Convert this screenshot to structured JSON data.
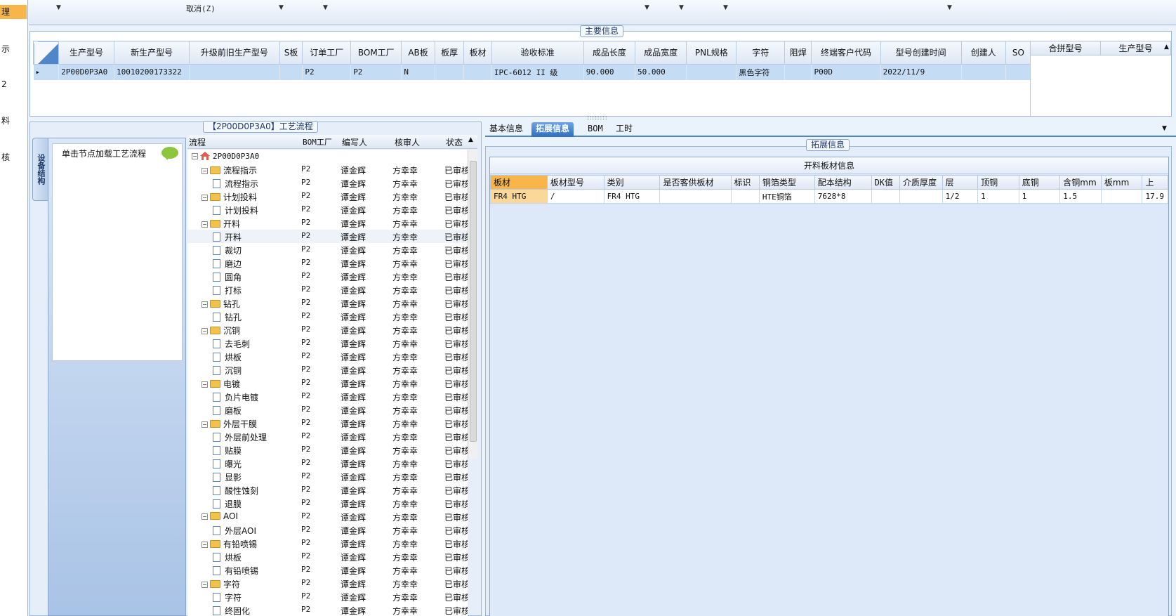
{
  "nav": {
    "items": [
      {
        "label": "理",
        "selected": true
      },
      {
        "label": "示",
        "selected": false
      },
      {
        "label": "2",
        "selected": false
      },
      {
        "label": "料",
        "selected": false
      },
      {
        "label": "核",
        "selected": false
      }
    ]
  },
  "toolbar": {
    "cancel_label": "取消(Z)"
  },
  "main_info": {
    "title": "主要信息",
    "columns": [
      "生产型号",
      "新生产型号",
      "升级前旧生产型号",
      "S板",
      "订单工厂",
      "BOM工厂",
      "AB板",
      "板厚",
      "板材",
      "验收标准",
      "成品长度",
      "成品宽度",
      "PNL规格",
      "字符",
      "阻焊",
      "终端客户代码",
      "型号创建时间",
      "创建人",
      "SO"
    ],
    "row": [
      "2P00D0P3A0",
      "10010200173322",
      "",
      "",
      "P2",
      "P2",
      "N",
      "",
      "",
      "IPC-6012 II 级",
      "90.000",
      "50.000",
      "",
      "黑色字符",
      "",
      "P00D",
      "2022/11/9",
      "",
      ""
    ],
    "side_columns": [
      "合拼型号",
      "生产型号"
    ]
  },
  "flow": {
    "title": "【2P00D0P3A0】工艺流程",
    "vertical_tab": "设备结构",
    "hint": "单击节点加载工艺流程",
    "columns": {
      "process": "流程",
      "bom_factory": "BOM工厂",
      "author": "编写人",
      "reviewer": "核审人",
      "status": "状态"
    },
    "root": "2P00D0P3A0",
    "rows": [
      {
        "level": 1,
        "type": "folder",
        "name": "流程指示",
        "factory": "P2",
        "author": "谭金辉",
        "reviewer": "方幸幸",
        "status": "已审核"
      },
      {
        "level": 2,
        "type": "doc",
        "name": "流程指示",
        "factory": "P2",
        "author": "谭金辉",
        "reviewer": "方幸幸",
        "status": "已审核"
      },
      {
        "level": 1,
        "type": "folder",
        "name": "计划投料",
        "factory": "P2",
        "author": "谭金辉",
        "reviewer": "方幸幸",
        "status": "已审核"
      },
      {
        "level": 2,
        "type": "doc",
        "name": "计划投料",
        "factory": "P2",
        "author": "谭金辉",
        "reviewer": "方幸幸",
        "status": "已审核"
      },
      {
        "level": 1,
        "type": "folder",
        "name": "开料",
        "factory": "P2",
        "author": "谭金辉",
        "reviewer": "方幸幸",
        "status": "已审核"
      },
      {
        "level": 2,
        "type": "doc",
        "name": "开料",
        "factory": "P2",
        "author": "谭金辉",
        "reviewer": "方幸幸",
        "status": "已审核",
        "highlight": true
      },
      {
        "level": 2,
        "type": "doc",
        "name": "裁切",
        "factory": "P2",
        "author": "谭金辉",
        "reviewer": "方幸幸",
        "status": "已审核"
      },
      {
        "level": 2,
        "type": "doc",
        "name": "磨边",
        "factory": "P2",
        "author": "谭金辉",
        "reviewer": "方幸幸",
        "status": "已审核"
      },
      {
        "level": 2,
        "type": "doc",
        "name": "圆角",
        "factory": "P2",
        "author": "谭金辉",
        "reviewer": "方幸幸",
        "status": "已审核"
      },
      {
        "level": 2,
        "type": "doc",
        "name": "打标",
        "factory": "P2",
        "author": "谭金辉",
        "reviewer": "方幸幸",
        "status": "已审核"
      },
      {
        "level": 1,
        "type": "folder",
        "name": "钻孔",
        "factory": "P2",
        "author": "谭金辉",
        "reviewer": "方幸幸",
        "status": "已审核"
      },
      {
        "level": 2,
        "type": "doc",
        "name": "钻孔",
        "factory": "P2",
        "author": "谭金辉",
        "reviewer": "方幸幸",
        "status": "已审核"
      },
      {
        "level": 1,
        "type": "folder",
        "name": "沉铜",
        "factory": "P2",
        "author": "谭金辉",
        "reviewer": "方幸幸",
        "status": "已审核"
      },
      {
        "level": 2,
        "type": "doc",
        "name": "去毛刺",
        "factory": "P2",
        "author": "谭金辉",
        "reviewer": "方幸幸",
        "status": "已审核"
      },
      {
        "level": 2,
        "type": "doc",
        "name": "烘板",
        "factory": "P2",
        "author": "谭金辉",
        "reviewer": "方幸幸",
        "status": "已审核"
      },
      {
        "level": 2,
        "type": "doc",
        "name": "沉铜",
        "factory": "P2",
        "author": "谭金辉",
        "reviewer": "方幸幸",
        "status": "已审核"
      },
      {
        "level": 1,
        "type": "folder",
        "name": "电镀",
        "factory": "P2",
        "author": "谭金辉",
        "reviewer": "方幸幸",
        "status": "已审核"
      },
      {
        "level": 2,
        "type": "doc",
        "name": "负片电镀",
        "factory": "P2",
        "author": "谭金辉",
        "reviewer": "方幸幸",
        "status": "已审核"
      },
      {
        "level": 2,
        "type": "doc",
        "name": "磨板",
        "factory": "P2",
        "author": "谭金辉",
        "reviewer": "方幸幸",
        "status": "已审核"
      },
      {
        "level": 1,
        "type": "folder",
        "name": "外层干膜",
        "factory": "P2",
        "author": "谭金辉",
        "reviewer": "方幸幸",
        "status": "已审核"
      },
      {
        "level": 2,
        "type": "doc",
        "name": "外层前处理",
        "factory": "P2",
        "author": "谭金辉",
        "reviewer": "方幸幸",
        "status": "已审核"
      },
      {
        "level": 2,
        "type": "doc",
        "name": "贴膜",
        "factory": "P2",
        "author": "谭金辉",
        "reviewer": "方幸幸",
        "status": "已审核"
      },
      {
        "level": 2,
        "type": "doc",
        "name": "曝光",
        "factory": "P2",
        "author": "谭金辉",
        "reviewer": "方幸幸",
        "status": "已审核"
      },
      {
        "level": 2,
        "type": "doc",
        "name": "显影",
        "factory": "P2",
        "author": "谭金辉",
        "reviewer": "方幸幸",
        "status": "已审核"
      },
      {
        "level": 2,
        "type": "doc",
        "name": "酸性蚀刻",
        "factory": "P2",
        "author": "谭金辉",
        "reviewer": "方幸幸",
        "status": "已审核"
      },
      {
        "level": 2,
        "type": "doc",
        "name": "退膜",
        "factory": "P2",
        "author": "谭金辉",
        "reviewer": "方幸幸",
        "status": "已审核"
      },
      {
        "level": 1,
        "type": "folder",
        "name": "AOI",
        "factory": "P2",
        "author": "谭金辉",
        "reviewer": "方幸幸",
        "status": "已审核"
      },
      {
        "level": 2,
        "type": "doc",
        "name": "外层AOI",
        "factory": "P2",
        "author": "谭金辉",
        "reviewer": "方幸幸",
        "status": "已审核"
      },
      {
        "level": 1,
        "type": "folder",
        "name": "有铅喷锡",
        "factory": "P2",
        "author": "谭金辉",
        "reviewer": "方幸幸",
        "status": "已审核"
      },
      {
        "level": 2,
        "type": "doc",
        "name": "烘板",
        "factory": "P2",
        "author": "谭金辉",
        "reviewer": "方幸幸",
        "status": "已审核"
      },
      {
        "level": 2,
        "type": "doc",
        "name": "有铅喷锡",
        "factory": "P2",
        "author": "谭金辉",
        "reviewer": "方幸幸",
        "status": "已审核"
      },
      {
        "level": 1,
        "type": "folder",
        "name": "字符",
        "factory": "P2",
        "author": "谭金辉",
        "reviewer": "方幸幸",
        "status": "已审核"
      },
      {
        "level": 2,
        "type": "doc",
        "name": "字符",
        "factory": "P2",
        "author": "谭金辉",
        "reviewer": "方幸幸",
        "status": "已审核"
      },
      {
        "level": 2,
        "type": "doc",
        "name": "终固化",
        "factory": "P2",
        "author": "谭金辉",
        "reviewer": "方幸幸",
        "status": "已审核"
      }
    ]
  },
  "tabs": [
    {
      "label": "基本信息",
      "active": false
    },
    {
      "label": "拓展信息",
      "active": true
    },
    {
      "label": "BOM",
      "active": false
    },
    {
      "label": "工时",
      "active": false
    }
  ],
  "ext_info": {
    "title": "拓展信息",
    "material_caption": "开料板材信息",
    "columns": [
      "板材",
      "板材型号",
      "类别",
      "是否客供板材",
      "标识",
      "铜箔类型",
      "配本结构",
      "DK值",
      "介质厚度",
      "层",
      "顶铜",
      "底铜",
      "含铜mm",
      "板mm",
      "上"
    ],
    "row": [
      "FR4 HTG",
      "/",
      "FR4 HTG",
      "",
      "",
      "HTE铜箔",
      "7628*8",
      "",
      "",
      "1/2",
      "1",
      "1",
      "1.5",
      "",
      "17.9"
    ]
  },
  "colors": {
    "accent": "#2f6fc0",
    "selection": "#c5dcf5",
    "highlight_orange": "#f7b54a",
    "folder": "#f2c14e",
    "bubble": "#8cc63f"
  }
}
